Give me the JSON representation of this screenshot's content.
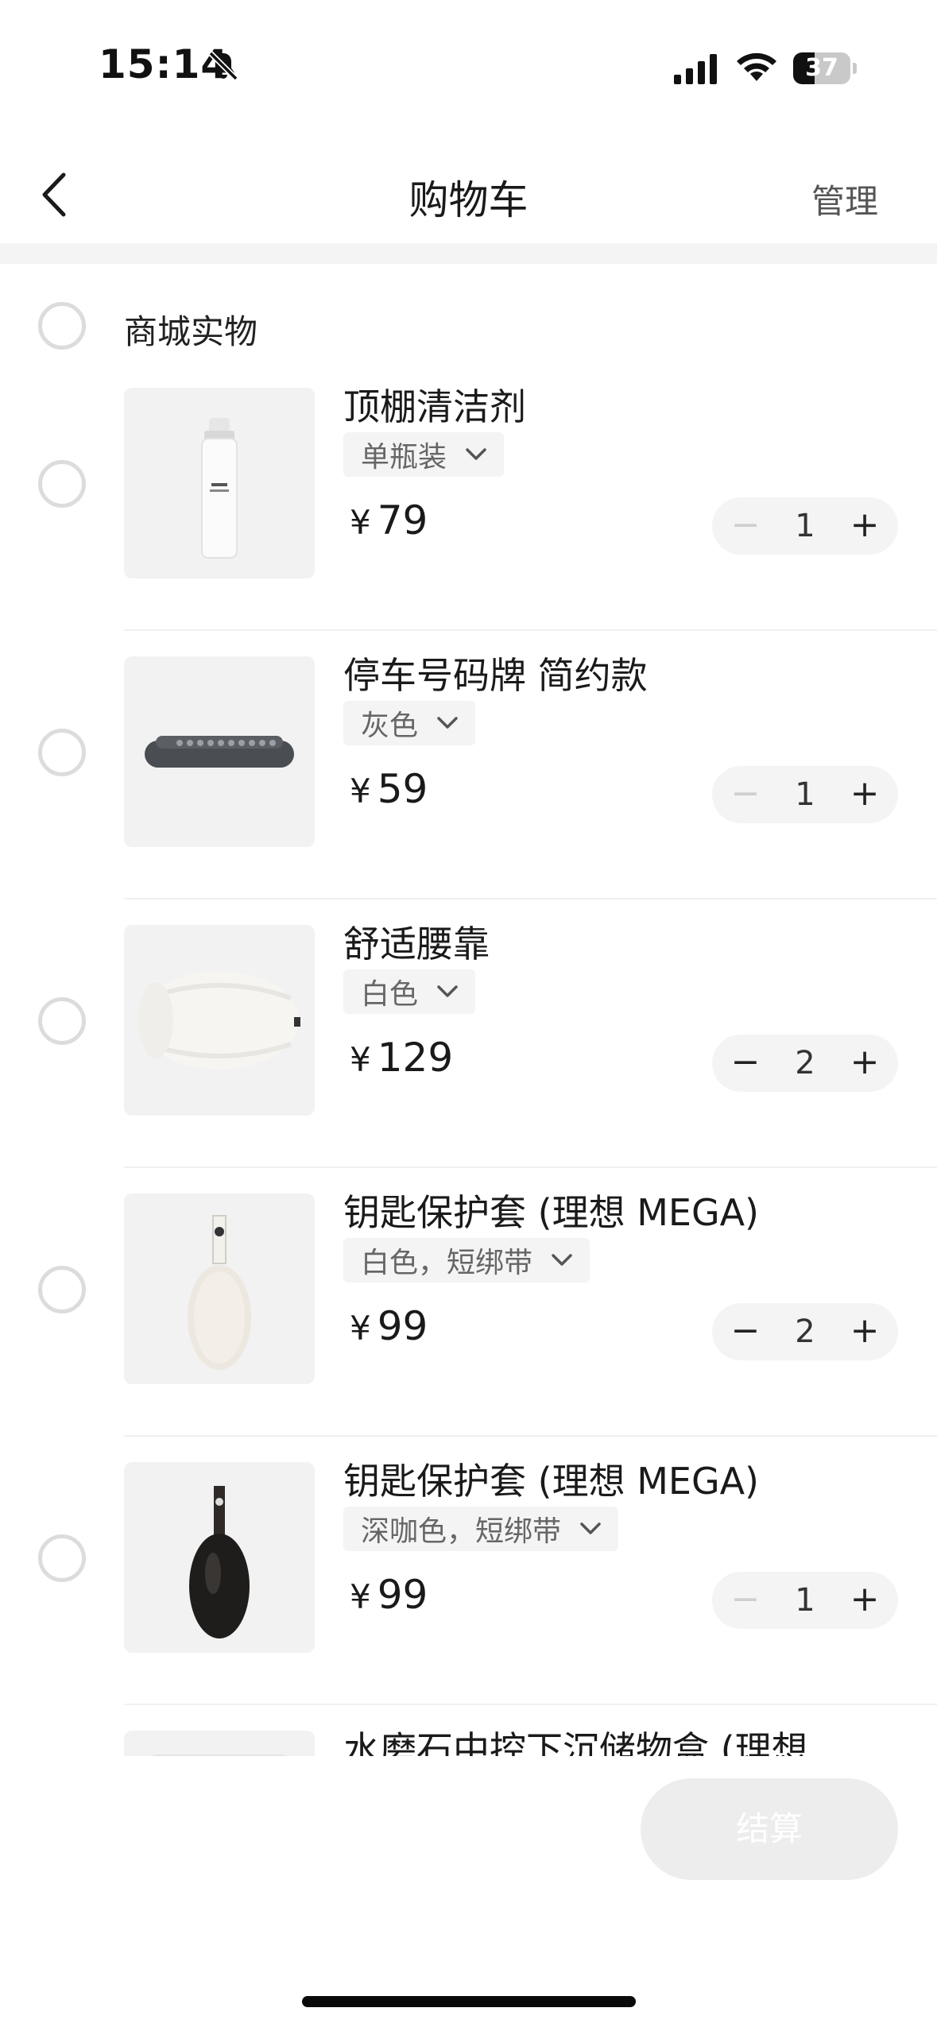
{
  "status_bar": {
    "time": "15:14",
    "battery": "37",
    "battery_level": 0.37,
    "icons": [
      "bell-slash-icon",
      "cellular-signal-icon",
      "wifi-icon",
      "battery-icon"
    ]
  },
  "nav": {
    "back_icon": "chevron-left-icon",
    "title": "购物车",
    "manage_label": "管理"
  },
  "group": {
    "label": "商城实物"
  },
  "items": [
    {
      "title": "顶棚清洁剂",
      "variant": "单瓶装",
      "currency": "¥",
      "price": "79",
      "quantity": "1",
      "minus": "−",
      "plus": "+",
      "minus_enabled": false,
      "image": "spray-bottle"
    },
    {
      "title": "停车号码牌 简约款",
      "variant": "灰色",
      "currency": "¥",
      "price": "59",
      "quantity": "1",
      "minus": "−",
      "plus": "+",
      "minus_enabled": false,
      "image": "parking-plate"
    },
    {
      "title": "舒适腰靠",
      "variant": "白色",
      "currency": "¥",
      "price": "129",
      "quantity": "2",
      "minus": "−",
      "plus": "+",
      "minus_enabled": true,
      "image": "lumbar-pillow"
    },
    {
      "title": "钥匙保护套 (理想 MEGA)",
      "variant": "白色，短绑带",
      "currency": "¥",
      "price": "99",
      "quantity": "2",
      "minus": "−",
      "plus": "+",
      "minus_enabled": true,
      "image": "key-case-white"
    },
    {
      "title": "钥匙保护套 (理想 MEGA)",
      "variant": "深咖色，短绑带",
      "currency": "¥",
      "price": "99",
      "quantity": "1",
      "minus": "−",
      "plus": "+",
      "minus_enabled": false,
      "image": "key-case-dark"
    },
    {
      "title": "水磨石中控下沉储物盒 (理想",
      "variant": "",
      "currency": "",
      "price": "",
      "quantity": "",
      "minus": "",
      "plus": "",
      "minus_enabled": false,
      "image": "storage-box"
    }
  ],
  "checkout": {
    "label": "结算"
  }
}
